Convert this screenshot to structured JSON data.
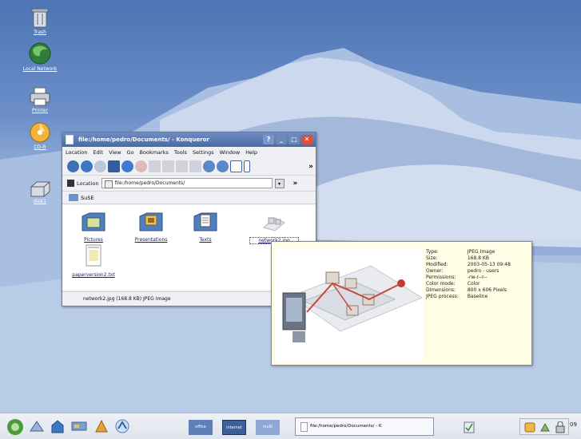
{
  "desktop_icons": [
    {
      "name": "trash",
      "label": "Trash"
    },
    {
      "name": "local-network",
      "label": "Local Network"
    },
    {
      "name": "printer",
      "label": "Printer"
    },
    {
      "name": "cdr",
      "label": "CD-R"
    },
    {
      "name": "disk",
      "label": "disk1"
    }
  ],
  "window": {
    "title": "file:/home/pedro/Documents/ - Konqueror",
    "menu": [
      "Location",
      "Edit",
      "View",
      "Go",
      "Bookmarks",
      "Tools",
      "Settings",
      "Window",
      "Help"
    ],
    "location_label": "Location",
    "location_value": "file:/home/pedro/Documents/",
    "bookmark": "SuSE",
    "files": [
      {
        "label": "Pictures",
        "icon": "folder-pictures-icon"
      },
      {
        "label": "Presentations",
        "icon": "folder-presentations-icon"
      },
      {
        "label": "Texts",
        "icon": "folder-texts-icon"
      },
      {
        "label": "network2.jpg",
        "icon": "image-file-icon"
      },
      {
        "label": "paperversion2.txt",
        "icon": "text-file-icon"
      }
    ],
    "status": "network2.jpg (168.8 KB)  JPEG Image"
  },
  "tooltip": {
    "rows": [
      {
        "key": "Type:",
        "value": "JPEG Image"
      },
      {
        "key": "Size:",
        "value": "168.8 KB"
      },
      {
        "key": "Modified:",
        "value": "2003-05-13 09:48"
      },
      {
        "key": "Owner:",
        "value": "pedro - users"
      },
      {
        "key": "Permissions:",
        "value": "-rw-r--r--"
      },
      {
        "key": "Color mode:",
        "value": "Color"
      },
      {
        "key": "Dimensions:",
        "value": "800 x 606 Pixels"
      },
      {
        "key": "JPEG process:",
        "value": "Baseline"
      }
    ]
  },
  "taskbar": {
    "pager": [
      "office",
      "internet",
      "multi"
    ],
    "task_title": "file:/home/pedro/Documents/ - K",
    "clock": "09"
  }
}
